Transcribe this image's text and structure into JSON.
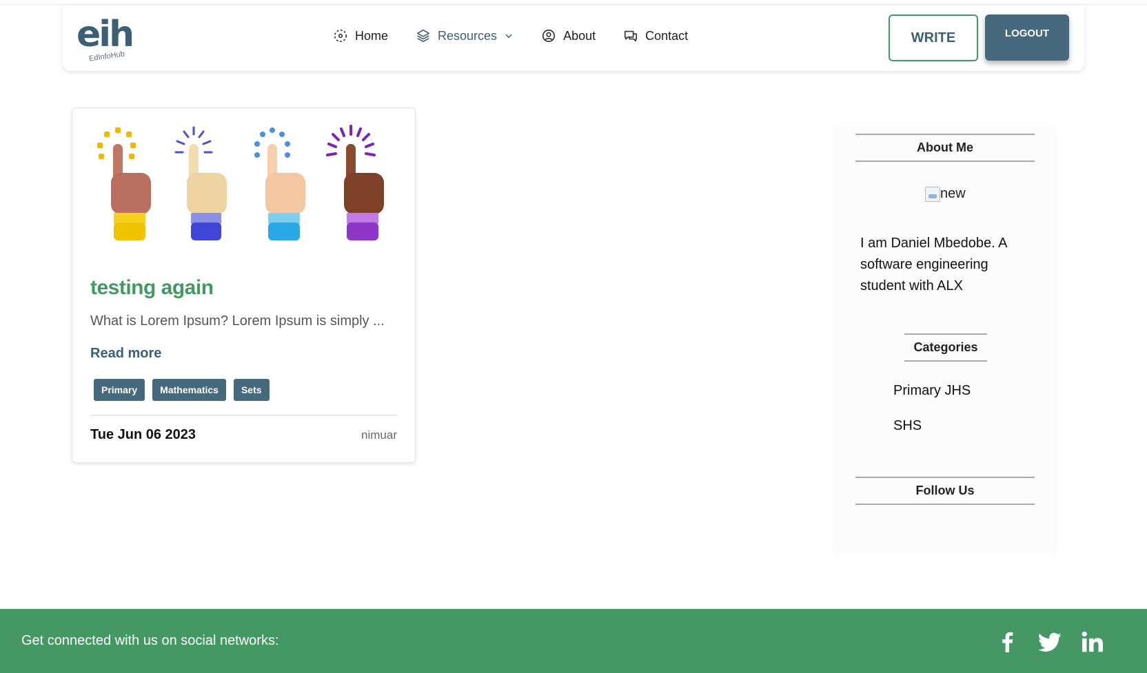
{
  "brand": {
    "logo_text": "eih",
    "logo_subtext": "EdInfoHub"
  },
  "nav": {
    "home": "Home",
    "resources": "Resources",
    "about": "About",
    "contact": "Contact",
    "write": "WRITE",
    "logout": "LOGOUT"
  },
  "post": {
    "title": "testing again",
    "excerpt": "What is Lorem Ipsum? Lorem Ipsum is simply ...",
    "read_more": "Read more",
    "tags": [
      "Primary",
      "Mathematics",
      "Sets"
    ],
    "date": "Tue Jun 06 2023",
    "author": "nimuar"
  },
  "sidebar": {
    "about_heading": "About Me",
    "image_alt": "new",
    "about_text": "I am Daniel Mbedobe. A software engineering student with ALX",
    "categories_heading": "Categories",
    "categories": [
      "Primary",
      "JHS",
      "SHS"
    ],
    "follow_heading": "Follow Us"
  },
  "footer": {
    "text": "Get connected with us on social networks:",
    "icons": [
      "facebook-icon",
      "twitter-icon",
      "linkedin-icon"
    ]
  },
  "colors": {
    "accent_green": "#449863",
    "slate": "#46697d",
    "title_blue": "#3c5f74"
  }
}
